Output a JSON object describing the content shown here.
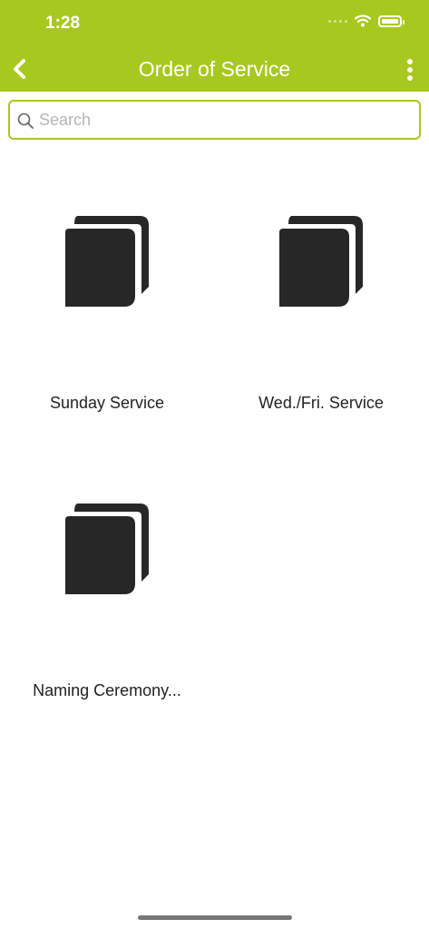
{
  "status_bar": {
    "time": "1:28"
  },
  "nav": {
    "title": "Order of Service",
    "back_icon": "chevron-left-icon",
    "more_icon": "more-vertical-icon"
  },
  "search": {
    "placeholder": "Search",
    "value": ""
  },
  "items": [
    {
      "label": "Sunday Service",
      "icon": "book-icon"
    },
    {
      "label": "Wed./Fri. Service",
      "icon": "book-icon"
    },
    {
      "label": "Naming Ceremony...",
      "icon": "book-icon"
    }
  ],
  "colors": {
    "accent": "#a7c81e",
    "icon": "#272727",
    "text": "#222222"
  }
}
